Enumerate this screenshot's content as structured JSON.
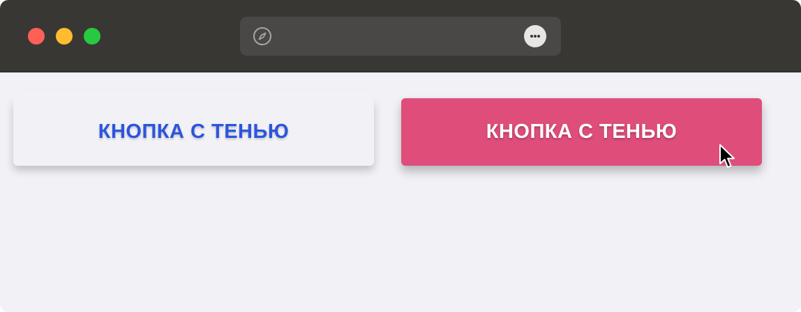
{
  "window": {
    "controls": {
      "close_color": "#fe5f57",
      "minimize_color": "#febc2e",
      "maximize_color": "#28c840"
    },
    "address_bar": {
      "left_icon": "compass-icon",
      "right_icon": "more-options-icon"
    }
  },
  "page": {
    "buttons": [
      {
        "label": "КНОПКА С ТЕНЬЮ",
        "style": "light",
        "text_color": "#2b55dd",
        "background": "#f1f1f6"
      },
      {
        "label": "КНОПКА С ТЕНЬЮ",
        "style": "accent",
        "text_color": "#ffffff",
        "background": "#df4e7b",
        "hovered": true
      }
    ]
  },
  "pointer": {
    "icon": "arrow-cursor-icon"
  }
}
